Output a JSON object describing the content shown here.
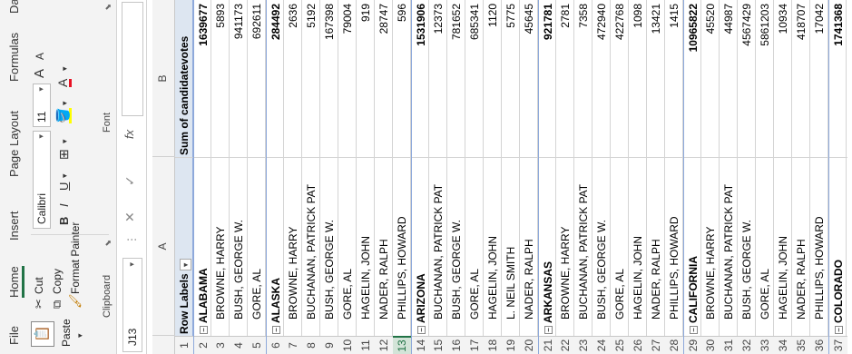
{
  "ribbon": {
    "tabs": [
      "File",
      "Home",
      "Insert",
      "Page Layout",
      "Formulas",
      "Da"
    ],
    "clipboard": {
      "label": "Clipboard",
      "paste": "Paste",
      "cut": "Cut",
      "copy": "Copy",
      "format_painter": "Format Painter"
    },
    "font": {
      "label": "Font",
      "font_name": "Calibri",
      "font_size": "11",
      "bold": "B",
      "italic": "I",
      "underline": "U",
      "grow": "A",
      "shrink": "A",
      "font_color_letter": "A"
    }
  },
  "formula_bar": {
    "name_box": "J13",
    "fx": "fx",
    "value": ""
  },
  "columns": [
    "A",
    "B"
  ],
  "pivot": {
    "header": {
      "row_labels": "Row Labels",
      "sum_label": "Sum of candidatevotes"
    },
    "rows": [
      {
        "n": "1",
        "a": "Row Labels",
        "b": "Sum of candidatevotes",
        "type": "header"
      },
      {
        "n": "2",
        "a": "ALABAMA",
        "b": "1639677",
        "type": "state"
      },
      {
        "n": "3",
        "a": "BROWNE, HARRY",
        "b": "5893",
        "type": "item"
      },
      {
        "n": "4",
        "a": "BUSH, GEORGE W.",
        "b": "941173",
        "type": "item"
      },
      {
        "n": "5",
        "a": "GORE, AL",
        "b": "692611",
        "type": "item"
      },
      {
        "n": "6",
        "a": "ALASKA",
        "b": "284492",
        "type": "state"
      },
      {
        "n": "7",
        "a": "BROWNE, HARRY",
        "b": "2636",
        "type": "item"
      },
      {
        "n": "8",
        "a": "BUCHANAN, PATRICK PAT",
        "b": "5192",
        "type": "item"
      },
      {
        "n": "9",
        "a": "BUSH, GEORGE W.",
        "b": "167398",
        "type": "item"
      },
      {
        "n": "10",
        "a": "GORE, AL",
        "b": "79004",
        "type": "item"
      },
      {
        "n": "11",
        "a": "HAGELIN, JOHN",
        "b": "919",
        "type": "item"
      },
      {
        "n": "12",
        "a": "NADER, RALPH",
        "b": "28747",
        "type": "item"
      },
      {
        "n": "13",
        "a": "PHILLIPS, HOWARD",
        "b": "596",
        "type": "item"
      },
      {
        "n": "14",
        "a": "ARIZONA",
        "b": "1531906",
        "type": "state"
      },
      {
        "n": "15",
        "a": "BUCHANAN, PATRICK PAT",
        "b": "12373",
        "type": "item"
      },
      {
        "n": "16",
        "a": "BUSH, GEORGE W.",
        "b": "781652",
        "type": "item"
      },
      {
        "n": "17",
        "a": "GORE, AL",
        "b": "685341",
        "type": "item"
      },
      {
        "n": "18",
        "a": "HAGELIN, JOHN",
        "b": "1120",
        "type": "item"
      },
      {
        "n": "19",
        "a": "L. NEIL SMITH",
        "b": "5775",
        "type": "item"
      },
      {
        "n": "20",
        "a": "NADER, RALPH",
        "b": "45645",
        "type": "item"
      },
      {
        "n": "21",
        "a": "ARKANSAS",
        "b": "921781",
        "type": "state"
      },
      {
        "n": "22",
        "a": "BROWNE, HARRY",
        "b": "2781",
        "type": "item"
      },
      {
        "n": "23",
        "a": "BUCHANAN, PATRICK PAT",
        "b": "7358",
        "type": "item"
      },
      {
        "n": "24",
        "a": "BUSH, GEORGE W.",
        "b": "472940",
        "type": "item"
      },
      {
        "n": "25",
        "a": "GORE, AL",
        "b": "422768",
        "type": "item"
      },
      {
        "n": "26",
        "a": "HAGELIN, JOHN",
        "b": "1098",
        "type": "item"
      },
      {
        "n": "27",
        "a": "NADER, RALPH",
        "b": "13421",
        "type": "item"
      },
      {
        "n": "28",
        "a": "PHILLIPS, HOWARD",
        "b": "1415",
        "type": "item"
      },
      {
        "n": "29",
        "a": "CALIFORNIA",
        "b": "10965822",
        "type": "state"
      },
      {
        "n": "30",
        "a": "BROWNE, HARRY",
        "b": "45520",
        "type": "item"
      },
      {
        "n": "31",
        "a": "BUCHANAN, PATRICK PAT",
        "b": "44987",
        "type": "item"
      },
      {
        "n": "32",
        "a": "BUSH, GEORGE W.",
        "b": "4567429",
        "type": "item"
      },
      {
        "n": "33",
        "a": "GORE, AL",
        "b": "5861203",
        "type": "item"
      },
      {
        "n": "34",
        "a": "HAGELIN, JOHN",
        "b": "10934",
        "type": "item"
      },
      {
        "n": "35",
        "a": "NADER, RALPH",
        "b": "418707",
        "type": "item"
      },
      {
        "n": "36",
        "a": "PHILLIPS, HOWARD",
        "b": "17042",
        "type": "item"
      },
      {
        "n": "37",
        "a": "COLORADO",
        "b": "1741368",
        "type": "state"
      }
    ]
  },
  "selected_row": "13",
  "colors": {
    "accent": "#217346",
    "header_fill": "#dde6f1",
    "font_color": "#e81123",
    "highlight": "#ffff00"
  }
}
